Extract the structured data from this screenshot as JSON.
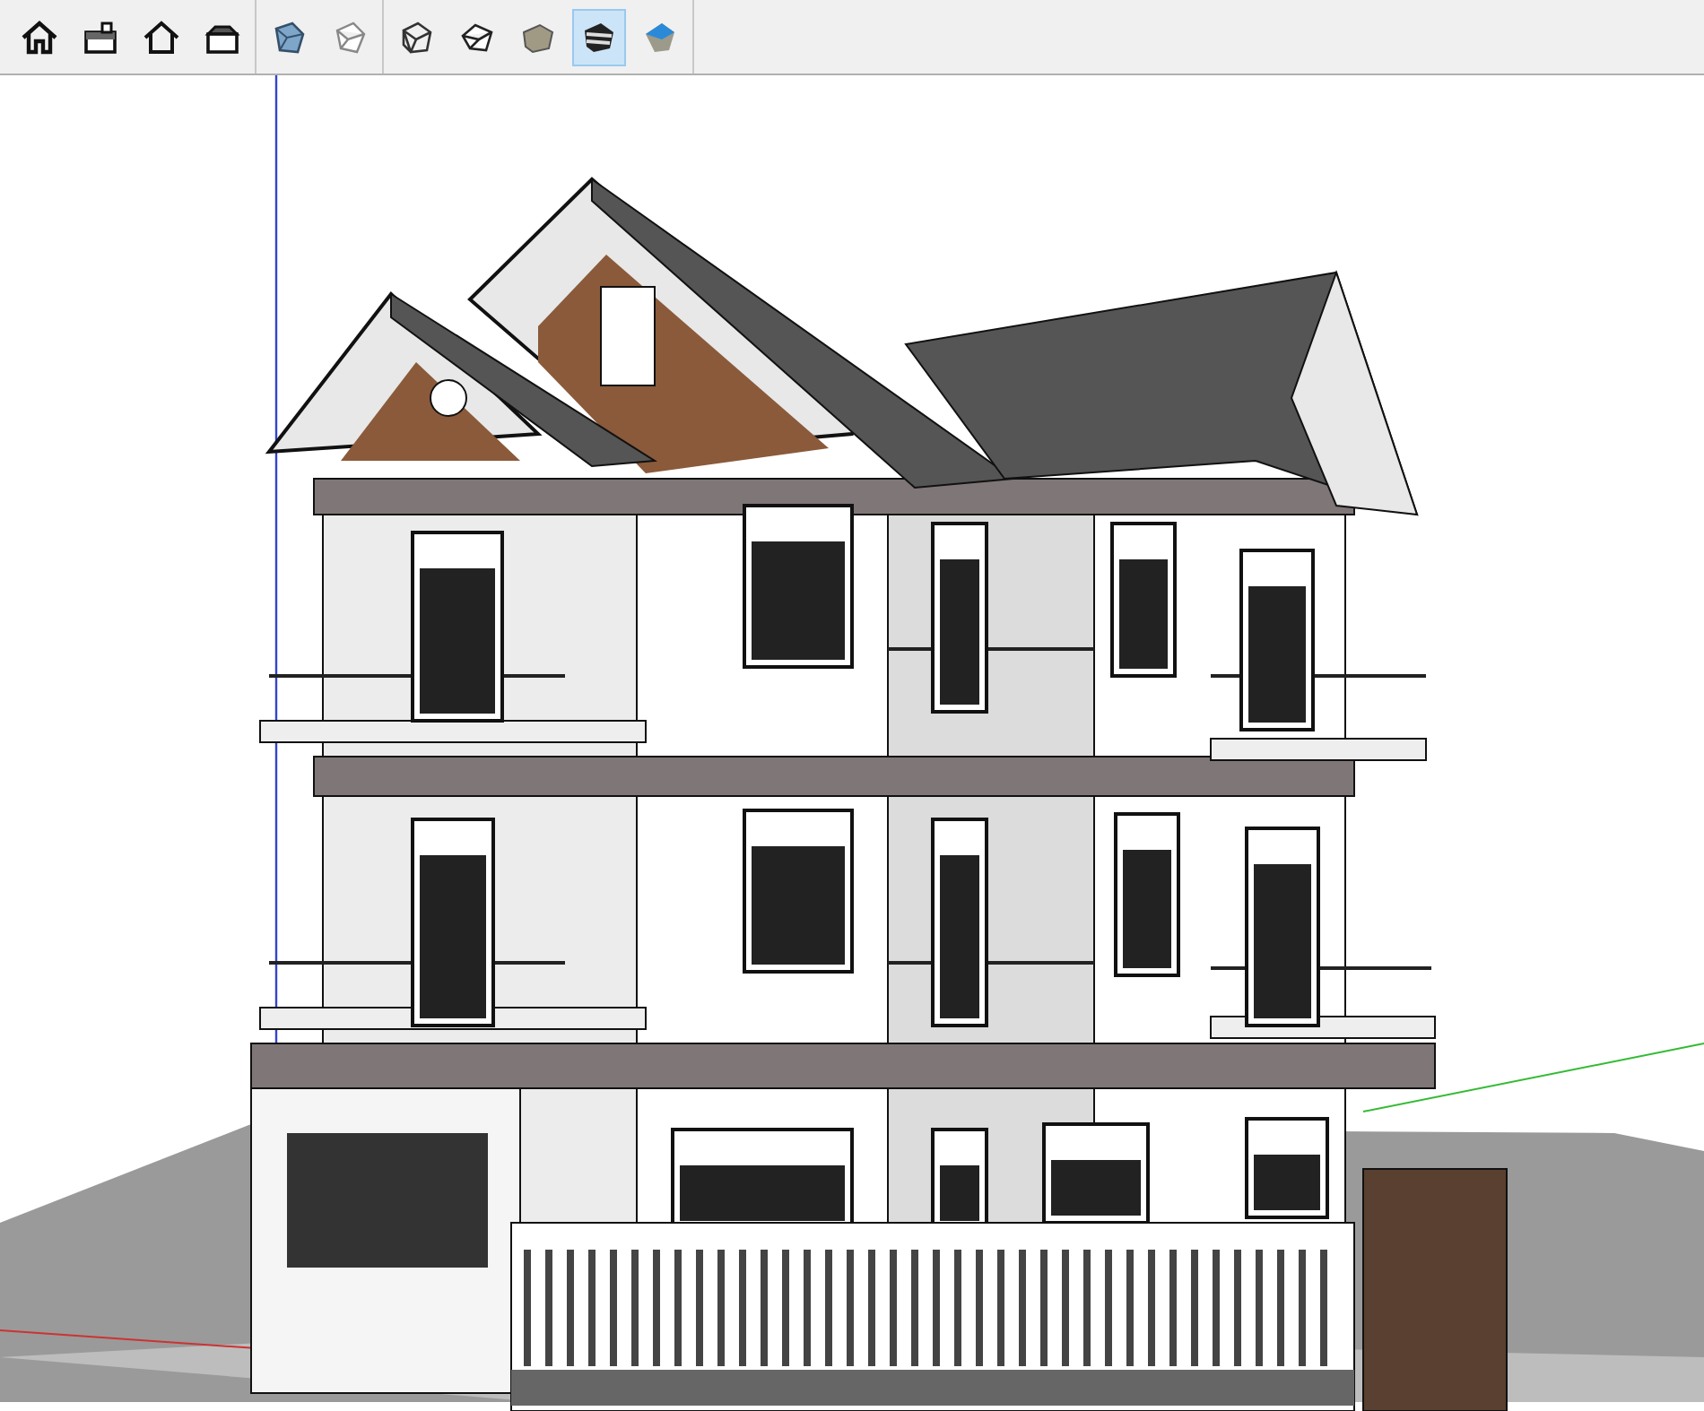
{
  "toolbars": [
    {
      "buttons": [
        {
          "kind": "iso",
          "selected": false
        },
        {
          "kind": "top",
          "selected": false
        },
        {
          "kind": "front",
          "selected": false
        },
        {
          "kind": "right",
          "selected": false
        }
      ]
    },
    {
      "buttons": [
        {
          "kind": "xray",
          "selected": false
        },
        {
          "kind": "backedges",
          "selected": false
        }
      ]
    },
    {
      "buttons": [
        {
          "kind": "wireframe",
          "selected": false
        },
        {
          "kind": "hiddenline",
          "selected": false
        },
        {
          "kind": "shaded",
          "selected": false
        },
        {
          "kind": "textured",
          "selected": true
        },
        {
          "kind": "monochrome",
          "selected": false
        }
      ]
    }
  ]
}
